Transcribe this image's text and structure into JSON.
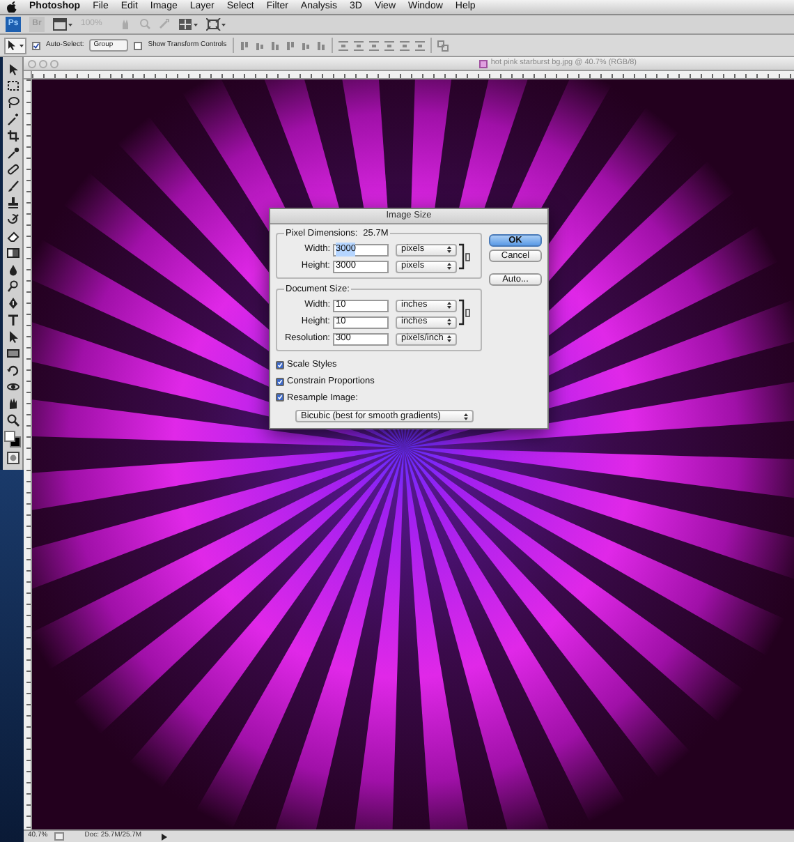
{
  "menu_bar": {
    "app_name": "Photoshop",
    "items": [
      "File",
      "Edit",
      "Image",
      "Layer",
      "Select",
      "Filter",
      "Analysis",
      "3D",
      "View",
      "Window",
      "Help"
    ]
  },
  "app_bar": {
    "logo": "Ps",
    "bridge": "Br",
    "zoom": "100%"
  },
  "options_bar": {
    "auto_select": {
      "label": "Auto-Select:",
      "checked": true
    },
    "auto_select_target": "Group",
    "show_transform": {
      "label": "Show Transform Controls",
      "checked": false
    }
  },
  "document": {
    "title": "hot pink starburst bg.jpg @ 40.7% (RGB/8)"
  },
  "dialog": {
    "title": "Image Size",
    "pixel_dimensions": {
      "legend": "Pixel Dimensions:",
      "value": "25.7M",
      "linked": true,
      "fields": [
        {
          "label": "Width:",
          "value": "3000",
          "unit": "pixels",
          "text_selected": true
        },
        {
          "label": "Height:",
          "value": "3000",
          "unit": "pixels",
          "text_selected": false
        }
      ]
    },
    "document_size": {
      "legend": "Document Size:",
      "linked": true,
      "fields": [
        {
          "label": "Width:",
          "value": "10",
          "unit": "inches"
        },
        {
          "label": "Height:",
          "value": "10",
          "unit": "inches"
        },
        {
          "label": "Resolution:",
          "value": "300",
          "unit": "pixels/inch"
        }
      ]
    },
    "checkboxes": [
      {
        "label": "Scale Styles",
        "checked": true
      },
      {
        "label": "Constrain Proportions",
        "checked": true
      },
      {
        "label": "Resample Image:",
        "checked": true
      }
    ],
    "resample_method": "Bicubic (best for smooth gradients)",
    "buttons": [
      {
        "label": "OK",
        "default": true
      },
      {
        "label": "Cancel",
        "default": false
      },
      {
        "label": "Auto...",
        "default": false
      }
    ]
  },
  "status_bar": {
    "zoom": "40.7%",
    "doc": "Doc: 25.7M/25.7M"
  }
}
